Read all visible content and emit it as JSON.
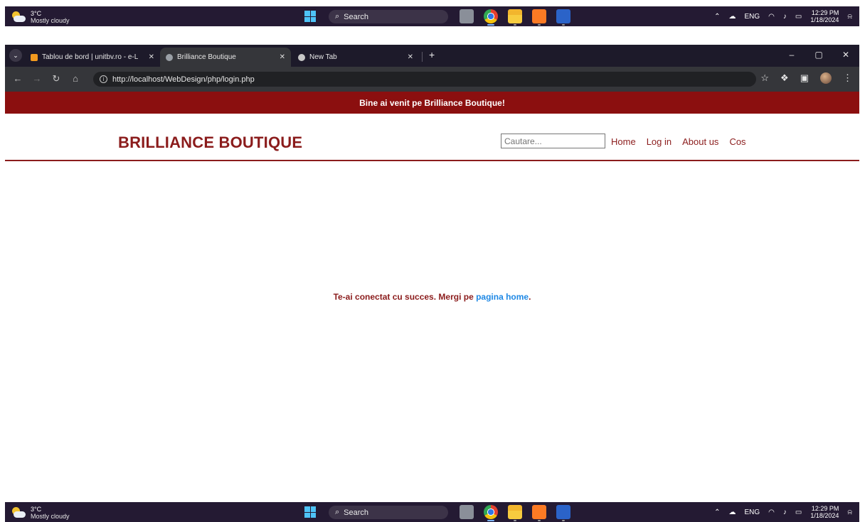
{
  "taskbar": {
    "weather_temp": "3°C",
    "weather_desc": "Mostly cloudy",
    "search_label": "Search",
    "tray_lang": "ENG",
    "time": "12:29 PM",
    "date": "1/18/2024"
  },
  "browser": {
    "tabs": [
      {
        "title": "Tablou de bord | unitbv.ro - e-L"
      },
      {
        "title": "Brilliance Boutique"
      },
      {
        "title": "New Tab"
      }
    ],
    "url": "http://localhost/WebDesign/php/login.php"
  },
  "site": {
    "banner": "Bine ai venit pe Brilliance Boutique!",
    "logo": "BRILLIANCE BOUTIQUE",
    "search_placeholder": "Cautare...",
    "nav": [
      "Home",
      "Log in",
      "About us",
      "Cos"
    ],
    "message_prefix": "Te-ai conectat cu succes. Mergi pe ",
    "message_link": "pagina home",
    "message_suffix": "."
  },
  "colors": {
    "brand": "#8b1c1c",
    "banner_bg": "#8b0f0f",
    "link": "#1e88e5",
    "taskbar_bg": "#241a33"
  }
}
